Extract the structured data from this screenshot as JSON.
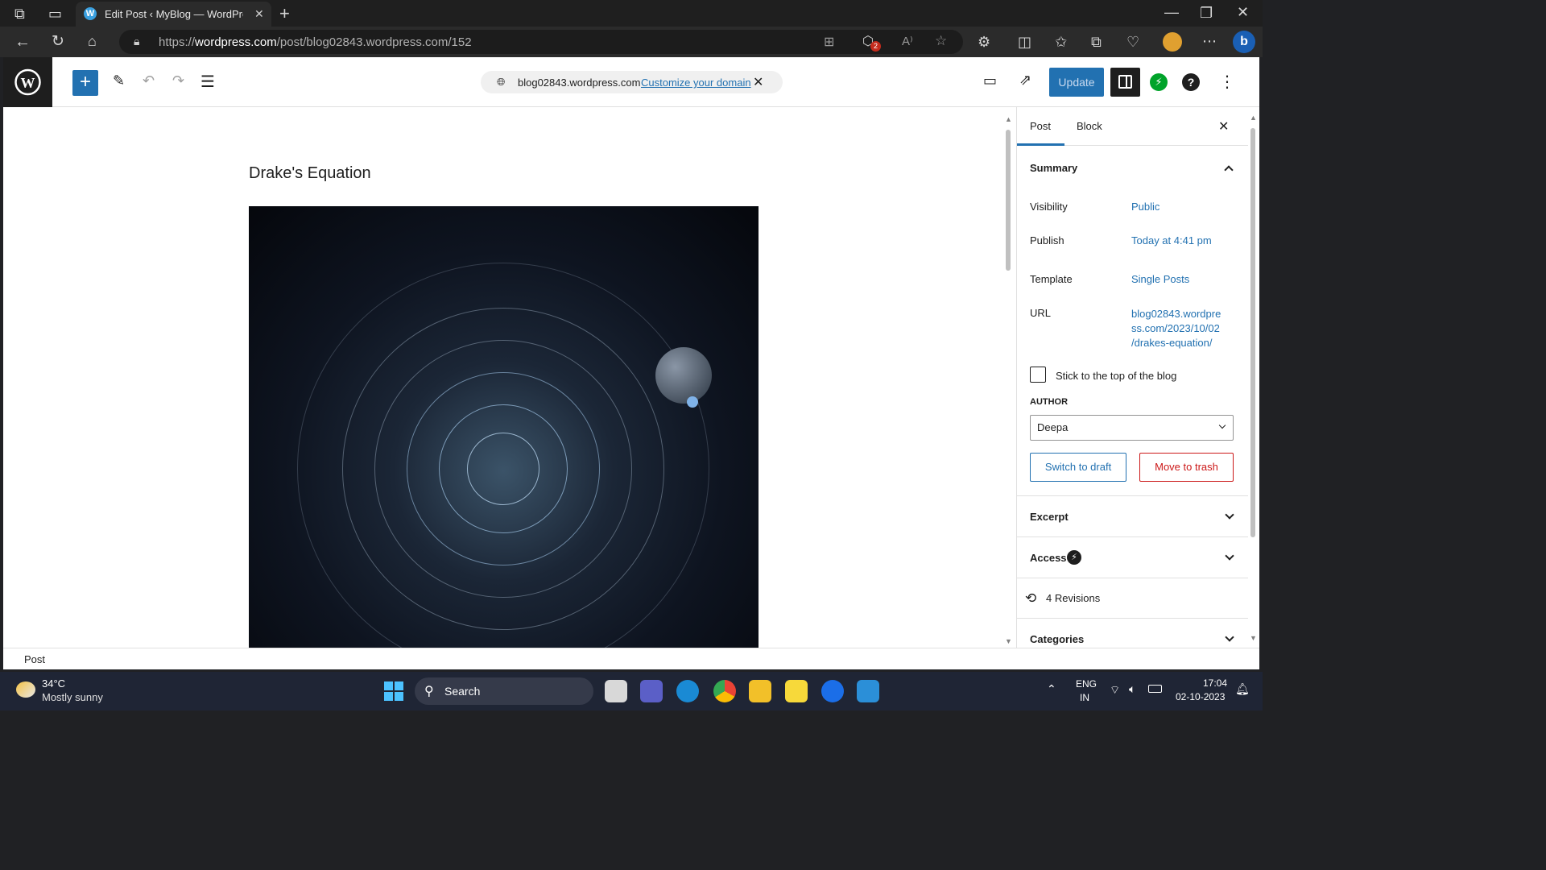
{
  "browser": {
    "tab_title": "Edit Post ‹ MyBlog — WordPress",
    "url_prefix": "https://",
    "url_domain": "wordpress.com",
    "url_path": "/post/blog02843.wordpress.com/152",
    "extension_badge": "2"
  },
  "header": {
    "site_domain": "blog02843.wordpress.com",
    "customize_domain": "Customize your domain",
    "update_label": "Update"
  },
  "post": {
    "title": "Drake's Equation"
  },
  "sidebar": {
    "tab_post": "Post",
    "tab_block": "Block",
    "summary": "Summary",
    "visibility_label": "Visibility",
    "visibility_value": "Public",
    "publish_label": "Publish",
    "publish_value": "Today at 4:41 pm",
    "template_label": "Template",
    "template_value": "Single Posts",
    "url_label": "URL",
    "url_line1": "blog02843.wordpre",
    "url_line2": "ss.com/2023/10/02",
    "url_line3": "/drakes-equation/",
    "sticky_label": "Stick to the top of the blog",
    "author_label": "AUTHOR",
    "author_value": "Deepa",
    "switch_draft": "Switch to draft",
    "move_trash": "Move to trash",
    "excerpt": "Excerpt",
    "access": "Access",
    "revisions": "4 Revisions",
    "categories": "Categories"
  },
  "statusbar": {
    "breadcrumb": "Post"
  },
  "taskbar": {
    "temp": "34°C",
    "weather": "Mostly sunny",
    "search": "Search",
    "lang1": "ENG",
    "lang2": "IN",
    "time": "17:04",
    "date": "02-10-2023"
  },
  "colors": {
    "accent": "#2271b1",
    "trash": "#cc1818",
    "dark": "#1e1e1e"
  }
}
